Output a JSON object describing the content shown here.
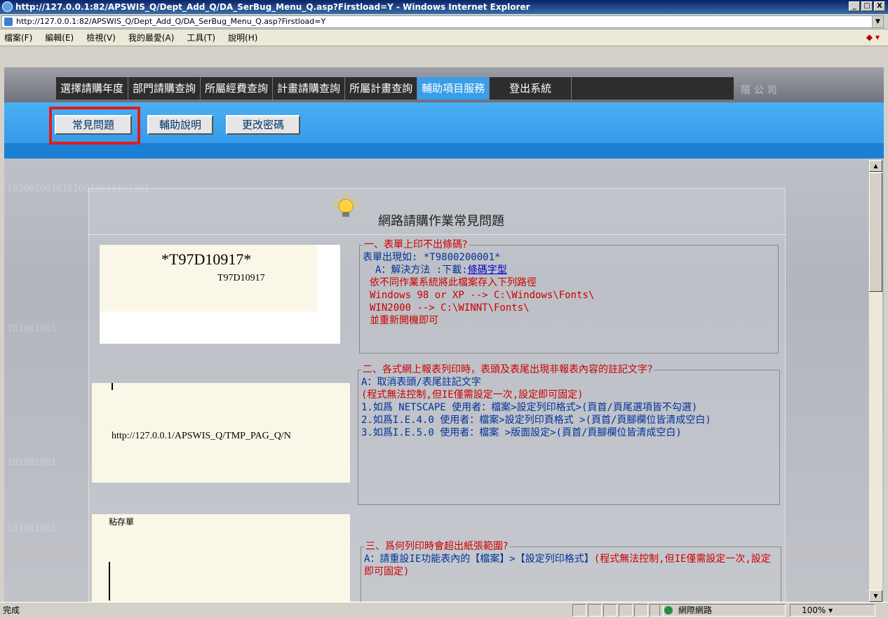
{
  "window": {
    "title": "http://127.0.0.1:82/APSWIS_Q/Dept_Add_Q/DA_SerBug_Menu_Q.asp?Firstload=Y - Windows Internet Explorer",
    "minimize": "_",
    "restore": "□",
    "close": "X"
  },
  "address": {
    "url": "http://127.0.0.1:82/APSWIS_Q/Dept_Add_Q/DA_SerBug_Menu_Q.asp?Firstload=Y"
  },
  "menu": [
    "檔案(F)",
    "編輯(E)",
    "檢視(V)",
    "我的最愛(A)",
    "工具(T)",
    "說明(H)"
  ],
  "nav": {
    "items": [
      "選擇請購年度",
      "部門請購查詢",
      "所屬經費查詢",
      "計畫請購查詢",
      "所屬計畫查詢",
      "輔助項目服務",
      "登出系統"
    ],
    "watermark": "限 公 司"
  },
  "subnav": {
    "faq": "常見問題",
    "help": "輔助說明",
    "password": "更改密碼"
  },
  "page": {
    "title": "網路請購作業常見問題"
  },
  "samples": {
    "barcode_big": "*T97D10917*",
    "barcode_small": "T97D10917",
    "header_url": "http://127.0.0.1/APSWIS_Q/TMP_PAG_Q/N",
    "label": "粘存單"
  },
  "faq1": {
    "legend": "一、表單上印不出條碼?",
    "l1": "表單出現如: *T9800200001*",
    "l2": "A：解決方法 :下載:",
    "l2_link": "條碼字型",
    "l3": "依不同作業系統將此檔案存入下列路徑",
    "l4": "Windows 98 or XP --> C:\\Windows\\Fonts\\",
    "l5": "WIN2000 --> C:\\WINNT\\Fonts\\",
    "l6": "並重新開機即可"
  },
  "faq2": {
    "legend": "二、各式網上報表列印時，表頭及表尾出現非報表內容的註記文字?",
    "l1": "A：取消表頭/表尾註記文字",
    "l2": "(程式無法控制,但IE僅需設定一次,設定即可固定)",
    "l3": "1.如爲 NETSCAPE 使用者：檔案>設定列印格式>(頁首/頁尾選項皆不勾選)",
    "l4": "2.如爲I.E.4.0 使用者：檔案>設定列印頁格式 >(頁首/頁腳欄位皆清成空白)",
    "l5": "3.如爲I.E.5.0 使用者：檔案 >版面設定>(頁首/頁腳欄位皆清成空白)"
  },
  "faq3": {
    "legend": "三、爲何列印時會超出紙張範圍?",
    "l1": "A：請重設IE功能表內的【檔案】>【設定列印格式】",
    "l2": "(程式無法控制,但IE僅需設定一次,設定即可固定)"
  },
  "status": {
    "text": "完成",
    "zone": "網際網路",
    "zoom": "100%"
  }
}
